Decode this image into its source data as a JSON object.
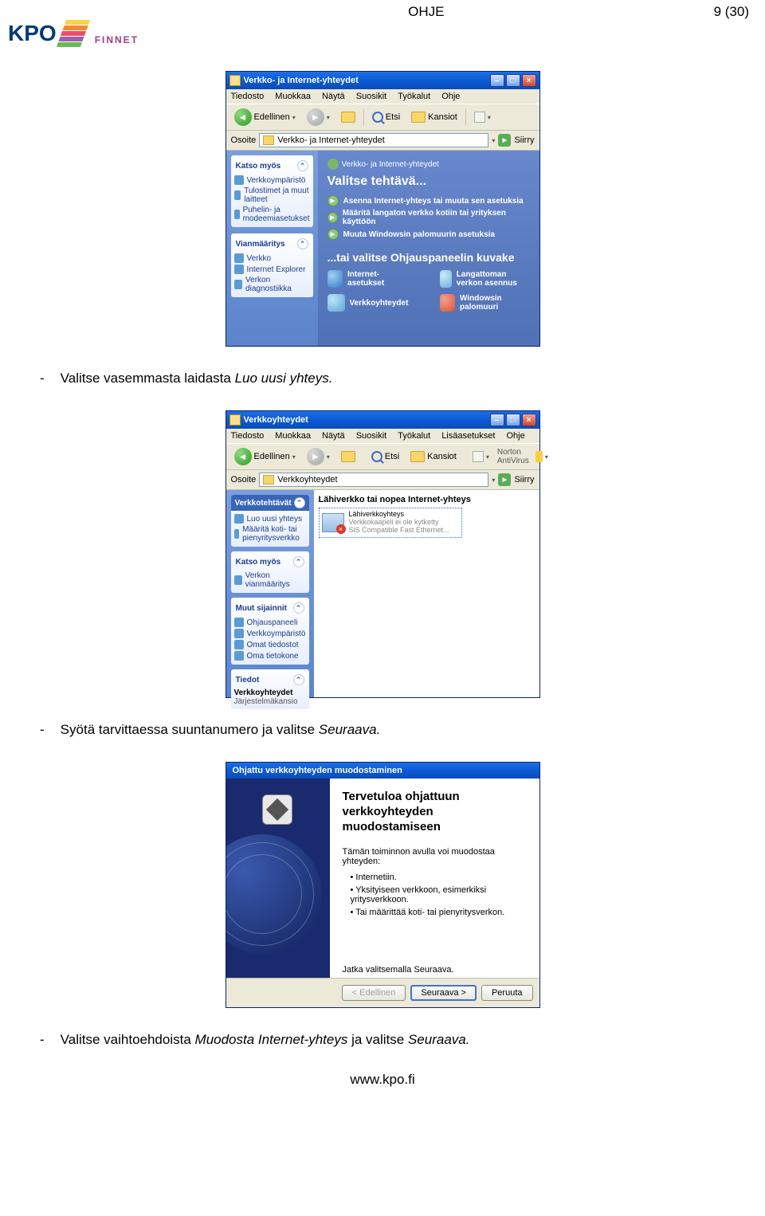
{
  "header": {
    "doc_title": "OHJE",
    "page_num": "9 (30)",
    "logo_main": "KPO",
    "logo_sub": "FINNET"
  },
  "bullets": {
    "b1_prefix": "Valitse vasemmasta laidasta ",
    "b1_italic": "Luo uusi yhteys.",
    "b2_prefix": "Syötä tarvittaessa suuntanumero ja valitse ",
    "b2_italic": "Seuraava.",
    "b3_prefix": "Valitse vaihtoehdoista ",
    "b3_italic": "Muodosta Internet-yhteys",
    "b3_suffix": " ja valitse ",
    "b3_italic2": "Seuraava."
  },
  "footer": "www.kpo.fi",
  "xp_menus": [
    "Tiedosto",
    "Muokkaa",
    "Näytä",
    "Suosikit",
    "Työkalut",
    "Ohje"
  ],
  "xp_menus2": [
    "Tiedosto",
    "Muokkaa",
    "Näytä",
    "Suosikit",
    "Työkalut",
    "Lisäasetukset",
    "Ohje"
  ],
  "toolbar": {
    "back": "Edellinen",
    "search": "Etsi",
    "folders": "Kansiot",
    "go": "Siirry",
    "address_label": "Osoite",
    "norton": "Norton AntiVirus"
  },
  "sc1": {
    "title": "Verkko- ja Internet-yhteydet",
    "address": "Verkko- ja Internet-yhteydet",
    "side_see": "Katso myös",
    "see_items": [
      "Verkkoympäristö",
      "Tulostimet ja muut laitteet",
      "Puhelin- ja modeemiasetukset"
    ],
    "side_trouble": "Vianmääritys",
    "trouble_items": [
      "Verkko",
      "Internet Explorer",
      "Verkon diagnostiikka"
    ],
    "category": "Verkko- ja Internet-yhteydet",
    "h1": "Valitse tehtävä...",
    "tasks": [
      "Asenna Internet-yhteys tai muuta sen asetuksia",
      "Määritä langaton verkko kotiin tai yrityksen käyttöön",
      "Muuta Windowsin palomuurin asetuksia"
    ],
    "h2": "...tai valitse Ohjauspaneelin kuvake",
    "cp": [
      "Internet-asetukset",
      "Verkkoyhteydet",
      "Langattoman verkon asennus",
      "Windowsin palomuuri"
    ]
  },
  "sc2": {
    "title": "Verkkoyhteydet",
    "address": "Verkkoyhteydet",
    "p1_head": "Verkkotehtävät",
    "p1_items": [
      "Luo uusi yhteys",
      "Määritä koti- tai pienyritysverkko"
    ],
    "p2_head": "Katso myös",
    "p2_items": [
      "Verkon vianmääritys"
    ],
    "p3_head": "Muut sijainnit",
    "p3_items": [
      "Ohjauspaneeli",
      "Verkkoympäristö",
      "Omat tiedostot",
      "Oma tietokone"
    ],
    "p4_head": "Tiedot",
    "p4_bold": "Verkkoyhteydet",
    "p4_sub": "Järjestelmäkansio",
    "group": "Lähiverkko tai nopea Internet-yhteys",
    "conn_name": "Lähiverkkoyhteys",
    "conn_sub1": "Verkkokaapeli ei ole kytketty",
    "conn_sub2": "SiS Compatible Fast Ethernet..."
  },
  "sc3": {
    "title": "Ohjattu verkkoyhteyden muodostaminen",
    "h": "Tervetuloa ohjattuun verkkoyhteyden muodostamiseen",
    "intro": "Tämän toiminnon avulla voi muodostaa yhteyden:",
    "li": [
      "Internetiin.",
      "Yksityiseen verkkoon, esimerkiksi yritysverkkoon.",
      "Tai määrittää koti- tai pienyritysverkon."
    ],
    "cont": "Jatka valitsemalla Seuraava.",
    "btn_back": "< Edellinen",
    "btn_next": "Seuraava >",
    "btn_cancel": "Peruuta"
  }
}
